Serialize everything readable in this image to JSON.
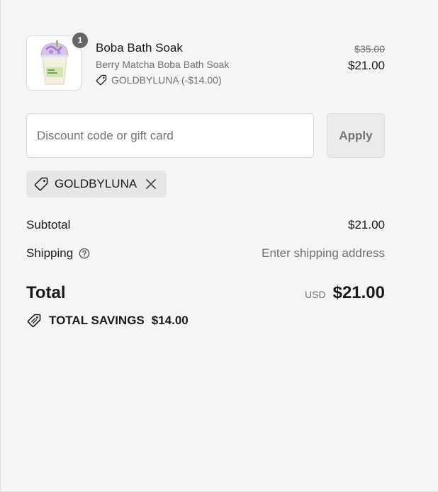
{
  "line_item": {
    "quantity": "1",
    "title": "Boba Bath Soak",
    "variant": "Berry Matcha Boba Bath Soak",
    "discount": "GOLDBYLUNA (-$14.00)",
    "original_price": "$35.00",
    "price": "$21.00",
    "image_icon": "product-thumbnail-icon"
  },
  "discount_form": {
    "placeholder": "Discount code or gift card",
    "apply_label": "Apply"
  },
  "applied_code": {
    "code": "GOLDBYLUNA",
    "tag_icon": "tag-icon",
    "remove_icon": "close-icon"
  },
  "summary": {
    "subtotal_label": "Subtotal",
    "subtotal_value": "$21.00",
    "shipping_label": "Shipping",
    "shipping_value": "Enter shipping address",
    "shipping_help_icon": "help-circle-icon",
    "total_label": "Total",
    "currency": "USD",
    "total_value": "$21.00",
    "savings_label": "TOTAL SAVINGS",
    "savings_value": "$14.00",
    "savings_icon": "savings-tag-icon"
  },
  "colors": {
    "background": "#f5f5f5",
    "text": "#1a1a1a",
    "muted": "#707070",
    "badge": "#666666",
    "tag_background": "#e6e6e6"
  }
}
